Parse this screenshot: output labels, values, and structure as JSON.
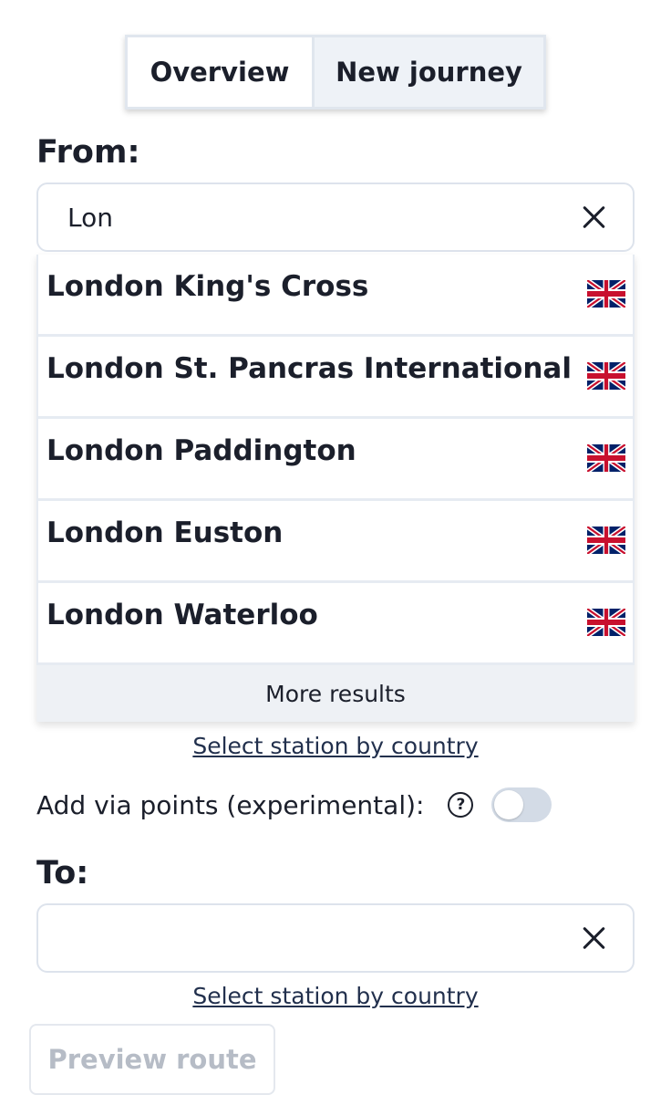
{
  "tabs": [
    {
      "label": "Overview",
      "active": true
    },
    {
      "label": "New journey",
      "active": false
    }
  ],
  "from": {
    "label": "From:",
    "value": "Lon",
    "suggestions": [
      {
        "name": "London King's Cross",
        "flag": "uk-flag-icon"
      },
      {
        "name": "London St. Pancras International",
        "flag": "uk-flag-icon"
      },
      {
        "name": "London Paddington",
        "flag": "uk-flag-icon"
      },
      {
        "name": "London Euston",
        "flag": "uk-flag-icon"
      },
      {
        "name": "London Waterloo",
        "flag": "uk-flag-icon"
      }
    ],
    "more_results": "More results",
    "select_by_country": "Select station by country"
  },
  "via": {
    "label": "Add via points (experimental):",
    "help_icon": "question-circle-icon",
    "enabled": false
  },
  "to": {
    "label": "To:",
    "value": "",
    "select_by_country": "Select station by country"
  },
  "preview_button": "Preview route",
  "colors": {
    "text": "#1b1f2b",
    "border": "#dde3ec",
    "toggle_off": "#d3dbe6",
    "link": "#22304d",
    "disabled_text": "#b6bcc6"
  }
}
